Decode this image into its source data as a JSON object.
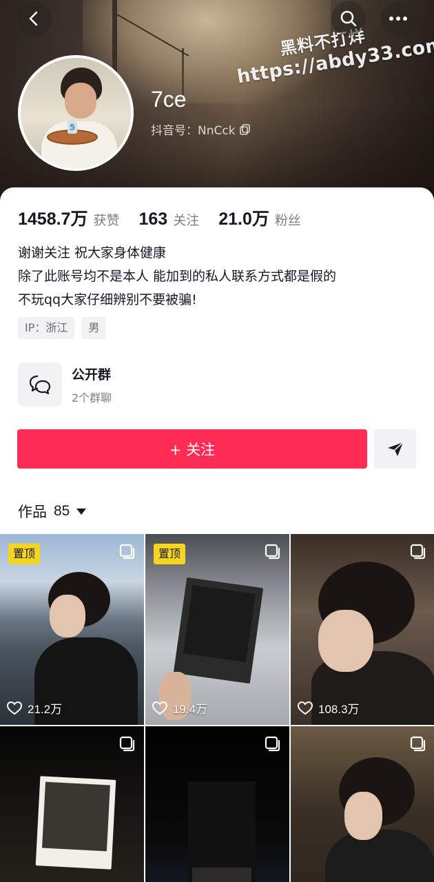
{
  "header": {
    "watermark_line1": "黑料不打烊",
    "watermark_line2": "https://abdy33.com",
    "username": "7ce",
    "douyin_id_label": "抖音号：NnCck",
    "icons": [
      "back-icon",
      "search-icon",
      "more-icon",
      "copy-icon"
    ]
  },
  "stats": [
    {
      "value": "1458.7万",
      "label": "获赞"
    },
    {
      "value": "163",
      "label": "关注"
    },
    {
      "value": "21.0万",
      "label": "粉丝"
    }
  ],
  "bio": [
    "谢谢关注 祝大家身体健康",
    "除了此账号均不是本人 能加到的私人联系方式都是假的",
    "不玩qq大家仔细辨别不要被骗!"
  ],
  "tags": [
    "IP：浙江",
    "男"
  ],
  "group": {
    "title": "公开群",
    "subtitle": "2个群聊",
    "icon": "chat-bubbles-icon"
  },
  "actions": {
    "follow_label": "+ 关注",
    "share_icon": "send-icon"
  },
  "works": {
    "label": "作品",
    "count": "85"
  },
  "videos": [
    {
      "pinned": "置顶",
      "likes": "21.2万"
    },
    {
      "pinned": "置顶",
      "likes": "19.4万"
    },
    {
      "pinned": "",
      "likes": "108.3万"
    },
    {
      "pinned": "",
      "likes": ""
    },
    {
      "pinned": "",
      "likes": ""
    },
    {
      "pinned": "",
      "likes": ""
    }
  ],
  "colors": {
    "follow_button": "#fe2c55",
    "pin_badge": "#f7d51f"
  }
}
